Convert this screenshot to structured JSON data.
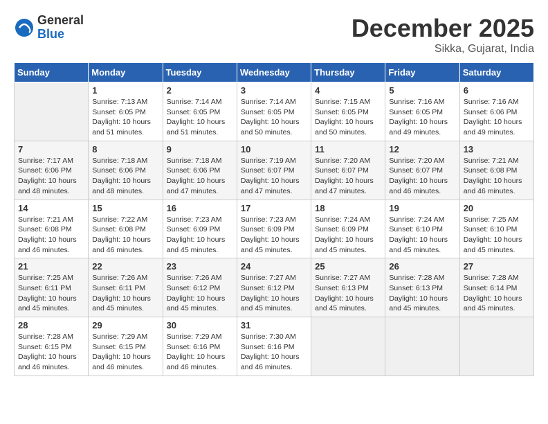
{
  "logo": {
    "general": "General",
    "blue": "Blue"
  },
  "title": "December 2025",
  "subtitle": "Sikka, Gujarat, India",
  "days_of_week": [
    "Sunday",
    "Monday",
    "Tuesday",
    "Wednesday",
    "Thursday",
    "Friday",
    "Saturday"
  ],
  "weeks": [
    [
      {
        "day": "",
        "info": ""
      },
      {
        "day": "1",
        "info": "Sunrise: 7:13 AM\nSunset: 6:05 PM\nDaylight: 10 hours\nand 51 minutes."
      },
      {
        "day": "2",
        "info": "Sunrise: 7:14 AM\nSunset: 6:05 PM\nDaylight: 10 hours\nand 51 minutes."
      },
      {
        "day": "3",
        "info": "Sunrise: 7:14 AM\nSunset: 6:05 PM\nDaylight: 10 hours\nand 50 minutes."
      },
      {
        "day": "4",
        "info": "Sunrise: 7:15 AM\nSunset: 6:05 PM\nDaylight: 10 hours\nand 50 minutes."
      },
      {
        "day": "5",
        "info": "Sunrise: 7:16 AM\nSunset: 6:05 PM\nDaylight: 10 hours\nand 49 minutes."
      },
      {
        "day": "6",
        "info": "Sunrise: 7:16 AM\nSunset: 6:06 PM\nDaylight: 10 hours\nand 49 minutes."
      }
    ],
    [
      {
        "day": "7",
        "info": "Sunrise: 7:17 AM\nSunset: 6:06 PM\nDaylight: 10 hours\nand 48 minutes."
      },
      {
        "day": "8",
        "info": "Sunrise: 7:18 AM\nSunset: 6:06 PM\nDaylight: 10 hours\nand 48 minutes."
      },
      {
        "day": "9",
        "info": "Sunrise: 7:18 AM\nSunset: 6:06 PM\nDaylight: 10 hours\nand 47 minutes."
      },
      {
        "day": "10",
        "info": "Sunrise: 7:19 AM\nSunset: 6:07 PM\nDaylight: 10 hours\nand 47 minutes."
      },
      {
        "day": "11",
        "info": "Sunrise: 7:20 AM\nSunset: 6:07 PM\nDaylight: 10 hours\nand 47 minutes."
      },
      {
        "day": "12",
        "info": "Sunrise: 7:20 AM\nSunset: 6:07 PM\nDaylight: 10 hours\nand 46 minutes."
      },
      {
        "day": "13",
        "info": "Sunrise: 7:21 AM\nSunset: 6:08 PM\nDaylight: 10 hours\nand 46 minutes."
      }
    ],
    [
      {
        "day": "14",
        "info": "Sunrise: 7:21 AM\nSunset: 6:08 PM\nDaylight: 10 hours\nand 46 minutes."
      },
      {
        "day": "15",
        "info": "Sunrise: 7:22 AM\nSunset: 6:08 PM\nDaylight: 10 hours\nand 46 minutes."
      },
      {
        "day": "16",
        "info": "Sunrise: 7:23 AM\nSunset: 6:09 PM\nDaylight: 10 hours\nand 45 minutes."
      },
      {
        "day": "17",
        "info": "Sunrise: 7:23 AM\nSunset: 6:09 PM\nDaylight: 10 hours\nand 45 minutes."
      },
      {
        "day": "18",
        "info": "Sunrise: 7:24 AM\nSunset: 6:09 PM\nDaylight: 10 hours\nand 45 minutes."
      },
      {
        "day": "19",
        "info": "Sunrise: 7:24 AM\nSunset: 6:10 PM\nDaylight: 10 hours\nand 45 minutes."
      },
      {
        "day": "20",
        "info": "Sunrise: 7:25 AM\nSunset: 6:10 PM\nDaylight: 10 hours\nand 45 minutes."
      }
    ],
    [
      {
        "day": "21",
        "info": "Sunrise: 7:25 AM\nSunset: 6:11 PM\nDaylight: 10 hours\nand 45 minutes."
      },
      {
        "day": "22",
        "info": "Sunrise: 7:26 AM\nSunset: 6:11 PM\nDaylight: 10 hours\nand 45 minutes."
      },
      {
        "day": "23",
        "info": "Sunrise: 7:26 AM\nSunset: 6:12 PM\nDaylight: 10 hours\nand 45 minutes."
      },
      {
        "day": "24",
        "info": "Sunrise: 7:27 AM\nSunset: 6:12 PM\nDaylight: 10 hours\nand 45 minutes."
      },
      {
        "day": "25",
        "info": "Sunrise: 7:27 AM\nSunset: 6:13 PM\nDaylight: 10 hours\nand 45 minutes."
      },
      {
        "day": "26",
        "info": "Sunrise: 7:28 AM\nSunset: 6:13 PM\nDaylight: 10 hours\nand 45 minutes."
      },
      {
        "day": "27",
        "info": "Sunrise: 7:28 AM\nSunset: 6:14 PM\nDaylight: 10 hours\nand 45 minutes."
      }
    ],
    [
      {
        "day": "28",
        "info": "Sunrise: 7:28 AM\nSunset: 6:15 PM\nDaylight: 10 hours\nand 46 minutes."
      },
      {
        "day": "29",
        "info": "Sunrise: 7:29 AM\nSunset: 6:15 PM\nDaylight: 10 hours\nand 46 minutes."
      },
      {
        "day": "30",
        "info": "Sunrise: 7:29 AM\nSunset: 6:16 PM\nDaylight: 10 hours\nand 46 minutes."
      },
      {
        "day": "31",
        "info": "Sunrise: 7:30 AM\nSunset: 6:16 PM\nDaylight: 10 hours\nand 46 minutes."
      },
      {
        "day": "",
        "info": ""
      },
      {
        "day": "",
        "info": ""
      },
      {
        "day": "",
        "info": ""
      }
    ]
  ]
}
